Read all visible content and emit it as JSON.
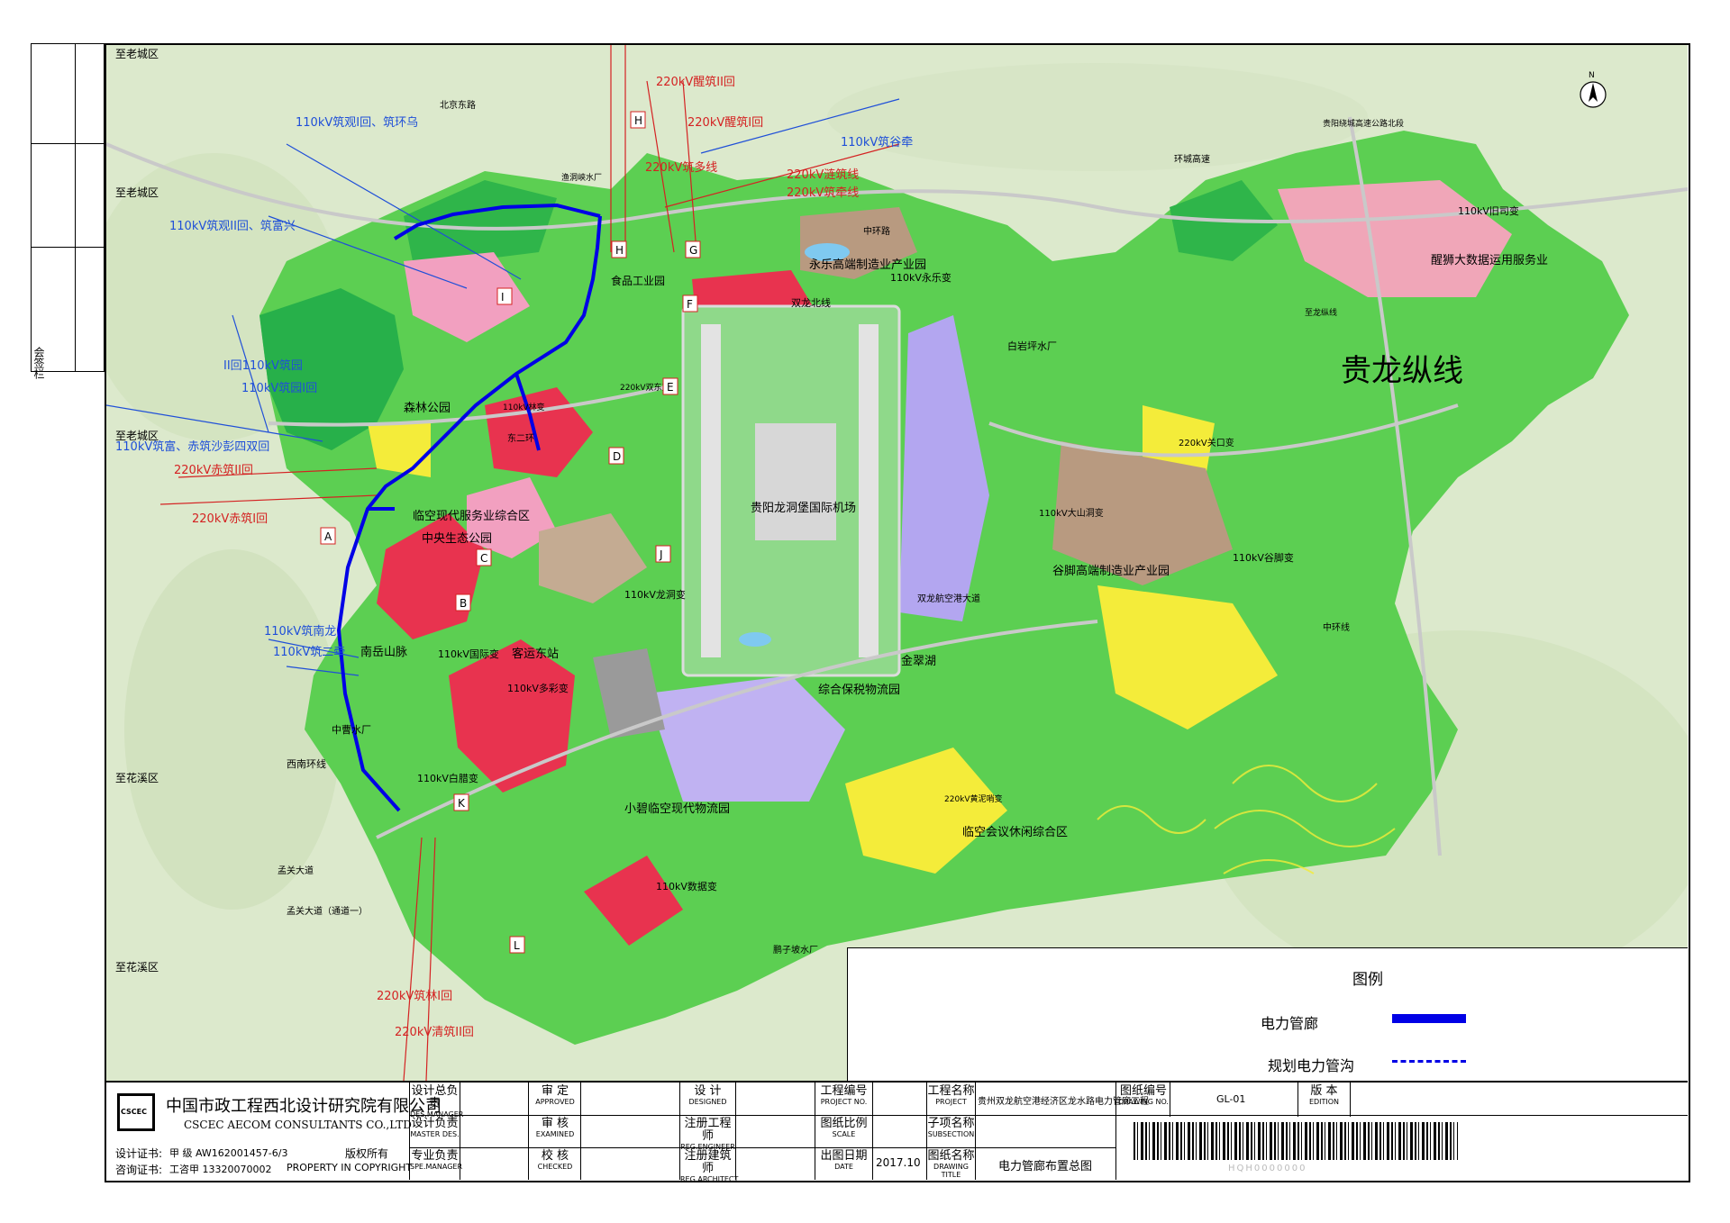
{
  "side_panel": {
    "label": "会签栏"
  },
  "map": {
    "north_arrow": "N",
    "main_title": "贵龙纵线",
    "colors": {
      "route": "#0000e6",
      "red_line": "#d42222",
      "blue_line": "#1f4fd8",
      "green_light": "#7fdc6a",
      "green_dark": "#2fb54a",
      "pink": "#f2a0c0",
      "red_zone": "#e8334f",
      "yellow": "#f4ec3a",
      "brown": "#b89a80",
      "purple": "#b3a6f0",
      "gray": "#9a9a9a",
      "terrain": "#d8e8c8"
    },
    "place_labels": [
      "至老城区",
      "至老城区",
      "至老城区",
      "至花溪区",
      "至花溪区",
      "森林公园",
      "临空现代服务业综合区",
      "中央生态公园",
      "南岳山脉",
      "中曹水厂",
      "西南环线",
      "客运东站",
      "110kV多彩变",
      "110kV国际变",
      "110kV白腊变",
      "小碧临空现代物流园",
      "110kV数据变",
      "综合保税物流园",
      "金翠湖",
      "贵阳龙洞堡国际机场",
      "永乐高端制造业产业园",
      "110kV永乐变",
      "双龙北线",
      "白岩坪水厂",
      "220kV关口变",
      "谷脚高端制造业产业园",
      "110kV大山洞变",
      "110kV谷脚变",
      "110kV旧司变",
      "醒狮大数据运用服务业",
      "220kV黄泥哨变",
      "临空会议休闲综合区",
      "食品工业园",
      "东二环",
      "渔洞峡水厂",
      "110kV龙洞变",
      "220kV双东变",
      "110kV林变",
      "孟关大道",
      "孟关大道（通道一）",
      "至龙纵线",
      "贵阳绕城高速公路北段",
      "中环路",
      "北京东路",
      "环城高速",
      "中环线",
      "双龙航空港大道",
      "鹏子坡水厂"
    ],
    "line_labels_red": [
      "220kV醒筑II回",
      "220kV醒筑I回",
      "220kV筑多线",
      "220kV涟筑线",
      "220kV筑牵线",
      "220kV赤筑II回",
      "220kV赤筑I回",
      "220kV筑林I回",
      "220kV清筑II回"
    ],
    "line_labels_blue": [
      "110kV筑观I回、筑环乌",
      "110kV筑观II回、筑富兴",
      "110kV筑富、赤筑沙彭四双回",
      "110kV筑谷牵",
      "110kV筑南龙",
      "110kV筑二牵",
      "II回110kV筑园",
      "110kV筑园I回"
    ],
    "nodes": [
      "A",
      "B",
      "C",
      "D",
      "E",
      "F",
      "G",
      "H",
      "H",
      "I",
      "J",
      "K",
      "L"
    ]
  },
  "legend": {
    "title": "图例",
    "items": [
      {
        "label": "电力管廊",
        "style": "solid"
      },
      {
        "label": "规划电力管沟",
        "style": "dash-dot"
      }
    ]
  },
  "title_block": {
    "company_cn": "中国市政工程西北设计研究院有限公司",
    "company_en": "CSCEC AECOM CONSULTANTS CO.,LTD",
    "logo_text": "CSCEC",
    "cert1_label": "设计证书:",
    "cert1_value": "甲  级 AW162001457-6/3",
    "cert2_label": "咨询证书:",
    "cert2_value": "工咨甲 13320070002",
    "copyright_cn": "版权所有",
    "copyright_en": "PROPERTY IN COPYRIGHT",
    "roles": [
      {
        "cn": "设计总负责",
        "en": "DES.MANAGER"
      },
      {
        "cn": "设计负责",
        "en": "MASTER DES."
      },
      {
        "cn": "专业负责",
        "en": "SPE.MANAGER"
      },
      {
        "cn": "审  定",
        "en": "APPROVED"
      },
      {
        "cn": "审  核",
        "en": "EXAMINED"
      },
      {
        "cn": "校  核",
        "en": "CHECKED"
      },
      {
        "cn": "设  计",
        "en": "DESIGNED"
      },
      {
        "cn": "注册工程师",
        "en": "REG.ENGINEER"
      },
      {
        "cn": "注册建筑师",
        "en": "REG.ARCHITECT"
      },
      {
        "cn": "工程编号",
        "en": "PROJECT NO."
      },
      {
        "cn": "图纸比例",
        "en": "SCALE"
      },
      {
        "cn": "出图日期",
        "en": "DATE"
      },
      {
        "cn": "工程名称",
        "en": "PROJECT"
      },
      {
        "cn": "子项名称",
        "en": "SUBSECTION"
      },
      {
        "cn": "图纸名称",
        "en": "DRAWING TITLE"
      },
      {
        "cn": "图纸编号",
        "en": "DRAWING NO."
      },
      {
        "cn": "版  本",
        "en": "EDITION"
      }
    ],
    "project_name": "贵州双龙航空港经济区龙水路电力管廊工程",
    "drawing_title": "电力管廊布置总图",
    "date": "2017.10",
    "drawing_no": "GL-01",
    "barcode_text": "HQH0000000"
  }
}
